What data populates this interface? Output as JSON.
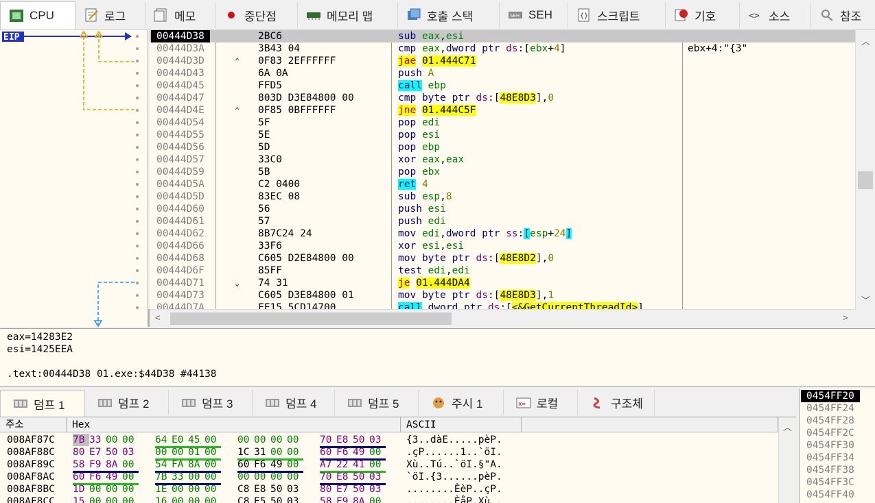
{
  "tabs": [
    {
      "label": "CPU",
      "icon": "cpu-icon"
    },
    {
      "label": "로그",
      "icon": "log-icon"
    },
    {
      "label": "메모",
      "icon": "notes-icon"
    },
    {
      "label": "중단점",
      "icon": "breakpoint-icon"
    },
    {
      "label": "메모리 맵",
      "icon": "memory-map-icon"
    },
    {
      "label": "호출 스택",
      "icon": "call-stack-icon"
    },
    {
      "label": "SEH",
      "icon": "seh-icon"
    },
    {
      "label": "스크립트",
      "icon": "script-icon"
    },
    {
      "label": "기호",
      "icon": "symbols-icon"
    },
    {
      "label": "소스",
      "icon": "source-icon"
    },
    {
      "label": "참조",
      "icon": "references-icon"
    }
  ],
  "eip_label": "EIP",
  "disasm": [
    {
      "addr": "00444D38",
      "arrow": "",
      "bytes": "2BC6",
      "instr": [
        [
          "mn",
          "sub"
        ],
        [
          "t",
          " "
        ],
        [
          "reg",
          "eax"
        ],
        [
          "t",
          ","
        ],
        [
          "reg",
          "esi"
        ]
      ],
      "comment": ""
    },
    {
      "addr": "00444D3A",
      "arrow": "",
      "bytes": "3B43 04",
      "instr": [
        [
          "mn",
          "cmp"
        ],
        [
          "t",
          " "
        ],
        [
          "reg",
          "eax"
        ],
        [
          "t",
          ","
        ],
        [
          "kw",
          "dword ptr"
        ],
        [
          "t",
          " "
        ],
        [
          "seg",
          "ds"
        ],
        [
          "t",
          ":["
        ],
        [
          "reg",
          "ebx"
        ],
        [
          "t",
          "+"
        ],
        [
          "imm",
          "4"
        ],
        [
          "t",
          "]"
        ]
      ],
      "comment": "ebx+4:\"{3\""
    },
    {
      "addr": "00444D3D",
      "arrow": "^",
      "bytes": "0F83 2EFFFFFF",
      "instr": [
        [
          "mnj",
          "jae"
        ],
        [
          "t",
          " "
        ],
        [
          "hl",
          "01.444C71"
        ]
      ],
      "comment": ""
    },
    {
      "addr": "00444D43",
      "arrow": "",
      "bytes": "6A 0A",
      "instr": [
        [
          "mn",
          "push"
        ],
        [
          "t",
          " "
        ],
        [
          "imm",
          "A"
        ]
      ],
      "comment": ""
    },
    {
      "addr": "00444D45",
      "arrow": "",
      "bytes": "FFD5",
      "instr": [
        [
          "mnc",
          "call"
        ],
        [
          "t",
          " "
        ],
        [
          "reg",
          "ebp"
        ]
      ],
      "comment": ""
    },
    {
      "addr": "00444D47",
      "arrow": "",
      "bytes": "803D D3E84800 00",
      "instr": [
        [
          "mn",
          "cmp"
        ],
        [
          "t",
          " "
        ],
        [
          "kw",
          "byte ptr"
        ],
        [
          "t",
          " "
        ],
        [
          "seg",
          "ds"
        ],
        [
          "t",
          ":["
        ],
        [
          "hl",
          "48E8D3"
        ],
        [
          "t",
          "],"
        ],
        [
          "imm",
          "0"
        ]
      ],
      "comment": ""
    },
    {
      "addr": "00444D4E",
      "arrow": "^",
      "bytes": "0F85 0BFFFFFF",
      "instr": [
        [
          "mnj",
          "jne"
        ],
        [
          "t",
          " "
        ],
        [
          "hl",
          "01.444C5F"
        ]
      ],
      "comment": ""
    },
    {
      "addr": "00444D54",
      "arrow": "",
      "bytes": "5F",
      "instr": [
        [
          "mn",
          "pop"
        ],
        [
          "t",
          " "
        ],
        [
          "reg",
          "edi"
        ]
      ],
      "comment": ""
    },
    {
      "addr": "00444D55",
      "arrow": "",
      "bytes": "5E",
      "instr": [
        [
          "mn",
          "pop"
        ],
        [
          "t",
          " "
        ],
        [
          "reg",
          "esi"
        ]
      ],
      "comment": ""
    },
    {
      "addr": "00444D56",
      "arrow": "",
      "bytes": "5D",
      "instr": [
        [
          "mn",
          "pop"
        ],
        [
          "t",
          " "
        ],
        [
          "reg",
          "ebp"
        ]
      ],
      "comment": ""
    },
    {
      "addr": "00444D57",
      "arrow": "",
      "bytes": "33C0",
      "instr": [
        [
          "mn",
          "xor"
        ],
        [
          "t",
          " "
        ],
        [
          "reg",
          "eax"
        ],
        [
          "t",
          ","
        ],
        [
          "reg",
          "eax"
        ]
      ],
      "comment": ""
    },
    {
      "addr": "00444D59",
      "arrow": "",
      "bytes": "5B",
      "instr": [
        [
          "mn",
          "pop"
        ],
        [
          "t",
          " "
        ],
        [
          "reg",
          "ebx"
        ]
      ],
      "comment": ""
    },
    {
      "addr": "00444D5A",
      "arrow": "",
      "bytes": "C2 0400",
      "instr": [
        [
          "mnc",
          "ret"
        ],
        [
          "t",
          " "
        ],
        [
          "imm",
          "4"
        ]
      ],
      "comment": ""
    },
    {
      "addr": "00444D5D",
      "arrow": "",
      "bytes": "83EC 08",
      "instr": [
        [
          "mn",
          "sub"
        ],
        [
          "t",
          " "
        ],
        [
          "reg",
          "esp"
        ],
        [
          "t",
          ","
        ],
        [
          "imm",
          "8"
        ]
      ],
      "comment": ""
    },
    {
      "addr": "00444D60",
      "arrow": "",
      "bytes": "56",
      "instr": [
        [
          "mn",
          "push"
        ],
        [
          "t",
          " "
        ],
        [
          "reg",
          "esi"
        ]
      ],
      "comment": ""
    },
    {
      "addr": "00444D61",
      "arrow": "",
      "bytes": "57",
      "instr": [
        [
          "mn",
          "push"
        ],
        [
          "t",
          " "
        ],
        [
          "reg",
          "edi"
        ]
      ],
      "comment": ""
    },
    {
      "addr": "00444D62",
      "arrow": "",
      "bytes": "8B7C24 24",
      "instr": [
        [
          "mn",
          "mov"
        ],
        [
          "t",
          " "
        ],
        [
          "reg",
          "edi"
        ],
        [
          "t",
          ","
        ],
        [
          "kw",
          "dword ptr"
        ],
        [
          "t",
          " "
        ],
        [
          "seg",
          "ss"
        ],
        [
          "t",
          ":"
        ],
        [
          "mnc",
          "["
        ],
        [
          "reg",
          "esp"
        ],
        [
          "t",
          "+"
        ],
        [
          "imm",
          "24"
        ],
        [
          "mnc",
          "]"
        ]
      ],
      "comment": ""
    },
    {
      "addr": "00444D66",
      "arrow": "",
      "bytes": "33F6",
      "instr": [
        [
          "mn",
          "xor"
        ],
        [
          "t",
          " "
        ],
        [
          "reg",
          "esi"
        ],
        [
          "t",
          ","
        ],
        [
          "reg",
          "esi"
        ]
      ],
      "comment": ""
    },
    {
      "addr": "00444D68",
      "arrow": "",
      "bytes": "C605 D2E84800 00",
      "instr": [
        [
          "mn",
          "mov"
        ],
        [
          "t",
          " "
        ],
        [
          "kw",
          "byte ptr"
        ],
        [
          "t",
          " "
        ],
        [
          "seg",
          "ds"
        ],
        [
          "t",
          ":["
        ],
        [
          "hl",
          "48E8D2"
        ],
        [
          "t",
          "],"
        ],
        [
          "imm",
          "0"
        ]
      ],
      "comment": ""
    },
    {
      "addr": "00444D6F",
      "arrow": "",
      "bytes": "85FF",
      "instr": [
        [
          "mn",
          "test"
        ],
        [
          "t",
          " "
        ],
        [
          "reg",
          "edi"
        ],
        [
          "t",
          ","
        ],
        [
          "reg",
          "edi"
        ]
      ],
      "comment": ""
    },
    {
      "addr": "00444D71",
      "arrow": "v",
      "bytes": "74 31",
      "instr": [
        [
          "mnj",
          "je"
        ],
        [
          "t",
          " "
        ],
        [
          "hl",
          "01.444DA4"
        ]
      ],
      "comment": ""
    },
    {
      "addr": "00444D73",
      "arrow": "",
      "bytes": "C605 D3E84800 01",
      "instr": [
        [
          "mn",
          "mov"
        ],
        [
          "t",
          " "
        ],
        [
          "kw",
          "byte ptr"
        ],
        [
          "t",
          " "
        ],
        [
          "seg",
          "ds"
        ],
        [
          "t",
          ":["
        ],
        [
          "hl",
          "48E8D3"
        ],
        [
          "t",
          "],"
        ],
        [
          "imm",
          "1"
        ]
      ],
      "comment": ""
    },
    {
      "addr": "00444D7A",
      "arrow": "",
      "bytes": "FF15 5CD14700",
      "instr": [
        [
          "mnc",
          "call"
        ],
        [
          "t",
          " "
        ],
        [
          "kw",
          "dword ptr"
        ],
        [
          "t",
          " "
        ],
        [
          "seg",
          "ds"
        ],
        [
          "t",
          ":["
        ],
        [
          "hl",
          "<&GetCurrentThreadId>"
        ],
        [
          "t",
          "]"
        ]
      ],
      "comment": ""
    }
  ],
  "info": {
    "line1": "eax=14283E2",
    "line2": "esi=1425EEA",
    "line3": ".text:00444D38 01.exe:$44D38 #44138"
  },
  "dump_tabs": [
    {
      "label": "덤프 1",
      "icon": "dump-icon"
    },
    {
      "label": "덤프 2",
      "icon": "dump-icon"
    },
    {
      "label": "덤프 3",
      "icon": "dump-icon"
    },
    {
      "label": "덤프 4",
      "icon": "dump-icon"
    },
    {
      "label": "덤프 5",
      "icon": "dump-icon"
    },
    {
      "label": "주시 1",
      "icon": "watch-icon"
    },
    {
      "label": "로컬",
      "icon": "locals-icon"
    },
    {
      "label": "구조체",
      "icon": "struct-icon"
    }
  ],
  "dump_headers": {
    "addr": "주소",
    "hex": "Hex",
    "ascii": "ASCII"
  },
  "dump": [
    {
      "addr": "008AF87C",
      "hex": [
        [
          "7B",
          "33",
          "00",
          "00"
        ],
        [
          "64",
          "E0",
          "45",
          "00"
        ],
        [
          "00",
          "00",
          "00",
          "00"
        ],
        [
          "70",
          "E8",
          "50",
          "03"
        ]
      ],
      "ascii": "{3..dàE.....pèP."
    },
    {
      "addr": "008AF88C",
      "hex": [
        [
          "80",
          "E7",
          "50",
          "03"
        ],
        [
          "00",
          "00",
          "01",
          "00"
        ],
        [
          "1C",
          "31",
          "00",
          "00"
        ],
        [
          "60",
          "F6",
          "49",
          "00"
        ]
      ],
      "ascii": ".çP......1..`öI."
    },
    {
      "addr": "008AF89C",
      "hex": [
        [
          "58",
          "F9",
          "8A",
          "00"
        ],
        [
          "54",
          "FA",
          "8A",
          "00"
        ],
        [
          "60",
          "F6",
          "49",
          "00"
        ],
        [
          "A7",
          "22",
          "41",
          "00"
        ]
      ],
      "ascii": "Xù..Tú..`öI.§\"A."
    },
    {
      "addr": "008AF8AC",
      "hex": [
        [
          "60",
          "F6",
          "49",
          "00"
        ],
        [
          "7B",
          "33",
          "00",
          "00"
        ],
        [
          "00",
          "00",
          "00",
          "00"
        ],
        [
          "70",
          "E8",
          "50",
          "03"
        ]
      ],
      "ascii": "`öI.{3......pèP."
    },
    {
      "addr": "008AF8BC",
      "hex": [
        [
          "1D",
          "00",
          "00",
          "00"
        ],
        [
          "1E",
          "00",
          "00",
          "00"
        ],
        [
          "C8",
          "E8",
          "50",
          "03"
        ],
        [
          "80",
          "E7",
          "50",
          "03"
        ]
      ],
      "ascii": "........ÈèP..çP."
    },
    {
      "addr": "008AF8CC",
      "hex": [
        [
          "15",
          "00",
          "00",
          "00"
        ],
        [
          "16",
          "00",
          "00",
          "00"
        ],
        [
          "C8",
          "E5",
          "50",
          "03"
        ],
        [
          "58",
          "F9",
          "8A",
          "00"
        ]
      ],
      "ascii": "........ÈåP.Xù.."
    }
  ],
  "stack": [
    {
      "addr": "0454FF20"
    },
    {
      "addr": "0454FF24"
    },
    {
      "addr": "0454FF28"
    },
    {
      "addr": "0454FF2C"
    },
    {
      "addr": "0454FF30"
    },
    {
      "addr": "0454FF34"
    },
    {
      "addr": "0454FF38"
    },
    {
      "addr": "0454FF3C"
    },
    {
      "addr": "0454FF40"
    }
  ]
}
